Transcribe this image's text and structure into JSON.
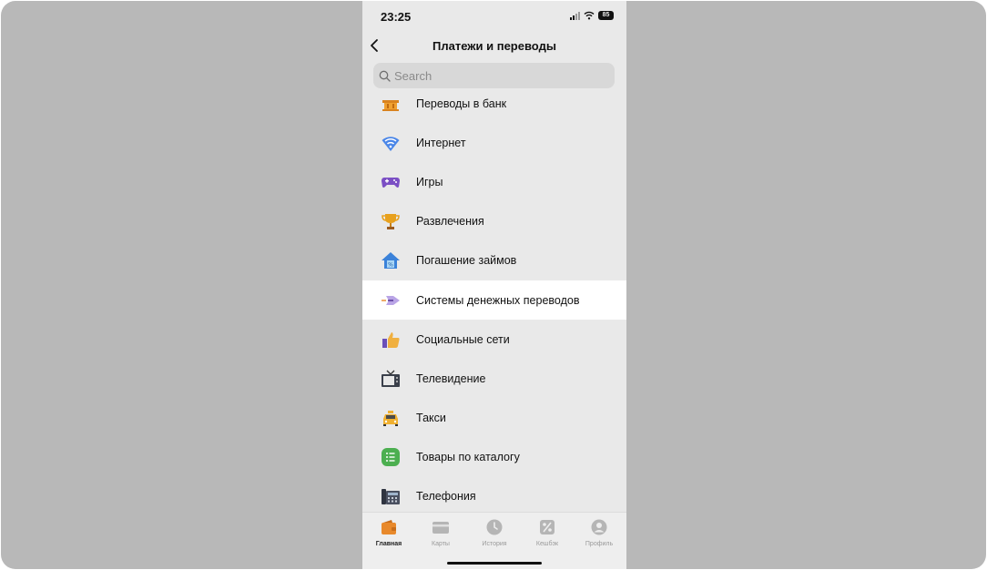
{
  "status_bar": {
    "time": "23:25",
    "battery": "85"
  },
  "nav": {
    "title": "Платежи и переводы"
  },
  "search": {
    "placeholder": "Search"
  },
  "list": [
    {
      "label": "Переводы в банк",
      "icon": "bank-icon"
    },
    {
      "label": "Интернет",
      "icon": "wifi-icon"
    },
    {
      "label": "Игры",
      "icon": "gamepad-icon"
    },
    {
      "label": "Развлечения",
      "icon": "trophy-icon"
    },
    {
      "label": "Погашение займов",
      "icon": "house-percent-icon"
    },
    {
      "label": "Системы денежных переводов",
      "icon": "money-transfer-icon",
      "selected": true
    },
    {
      "label": "Социальные сети",
      "icon": "thumbs-up-icon"
    },
    {
      "label": "Телевидение",
      "icon": "tv-icon"
    },
    {
      "label": "Такси",
      "icon": "taxi-icon"
    },
    {
      "label": "Товары по каталогу",
      "icon": "catalog-list-icon"
    },
    {
      "label": "Телефония",
      "icon": "phone-icon"
    }
  ],
  "tabs": [
    {
      "label": "Главная",
      "icon": "wallet-icon",
      "active": true
    },
    {
      "label": "Карты",
      "icon": "card-icon"
    },
    {
      "label": "История",
      "icon": "clock-icon"
    },
    {
      "label": "Кешбэк",
      "icon": "percent-icon"
    },
    {
      "label": "Профиль",
      "icon": "profile-icon"
    }
  ],
  "colors": {
    "accent": "#e8892b",
    "selected_row": "#ffffff",
    "background": "#e9e9e9",
    "outer": "#b8b8b8"
  }
}
